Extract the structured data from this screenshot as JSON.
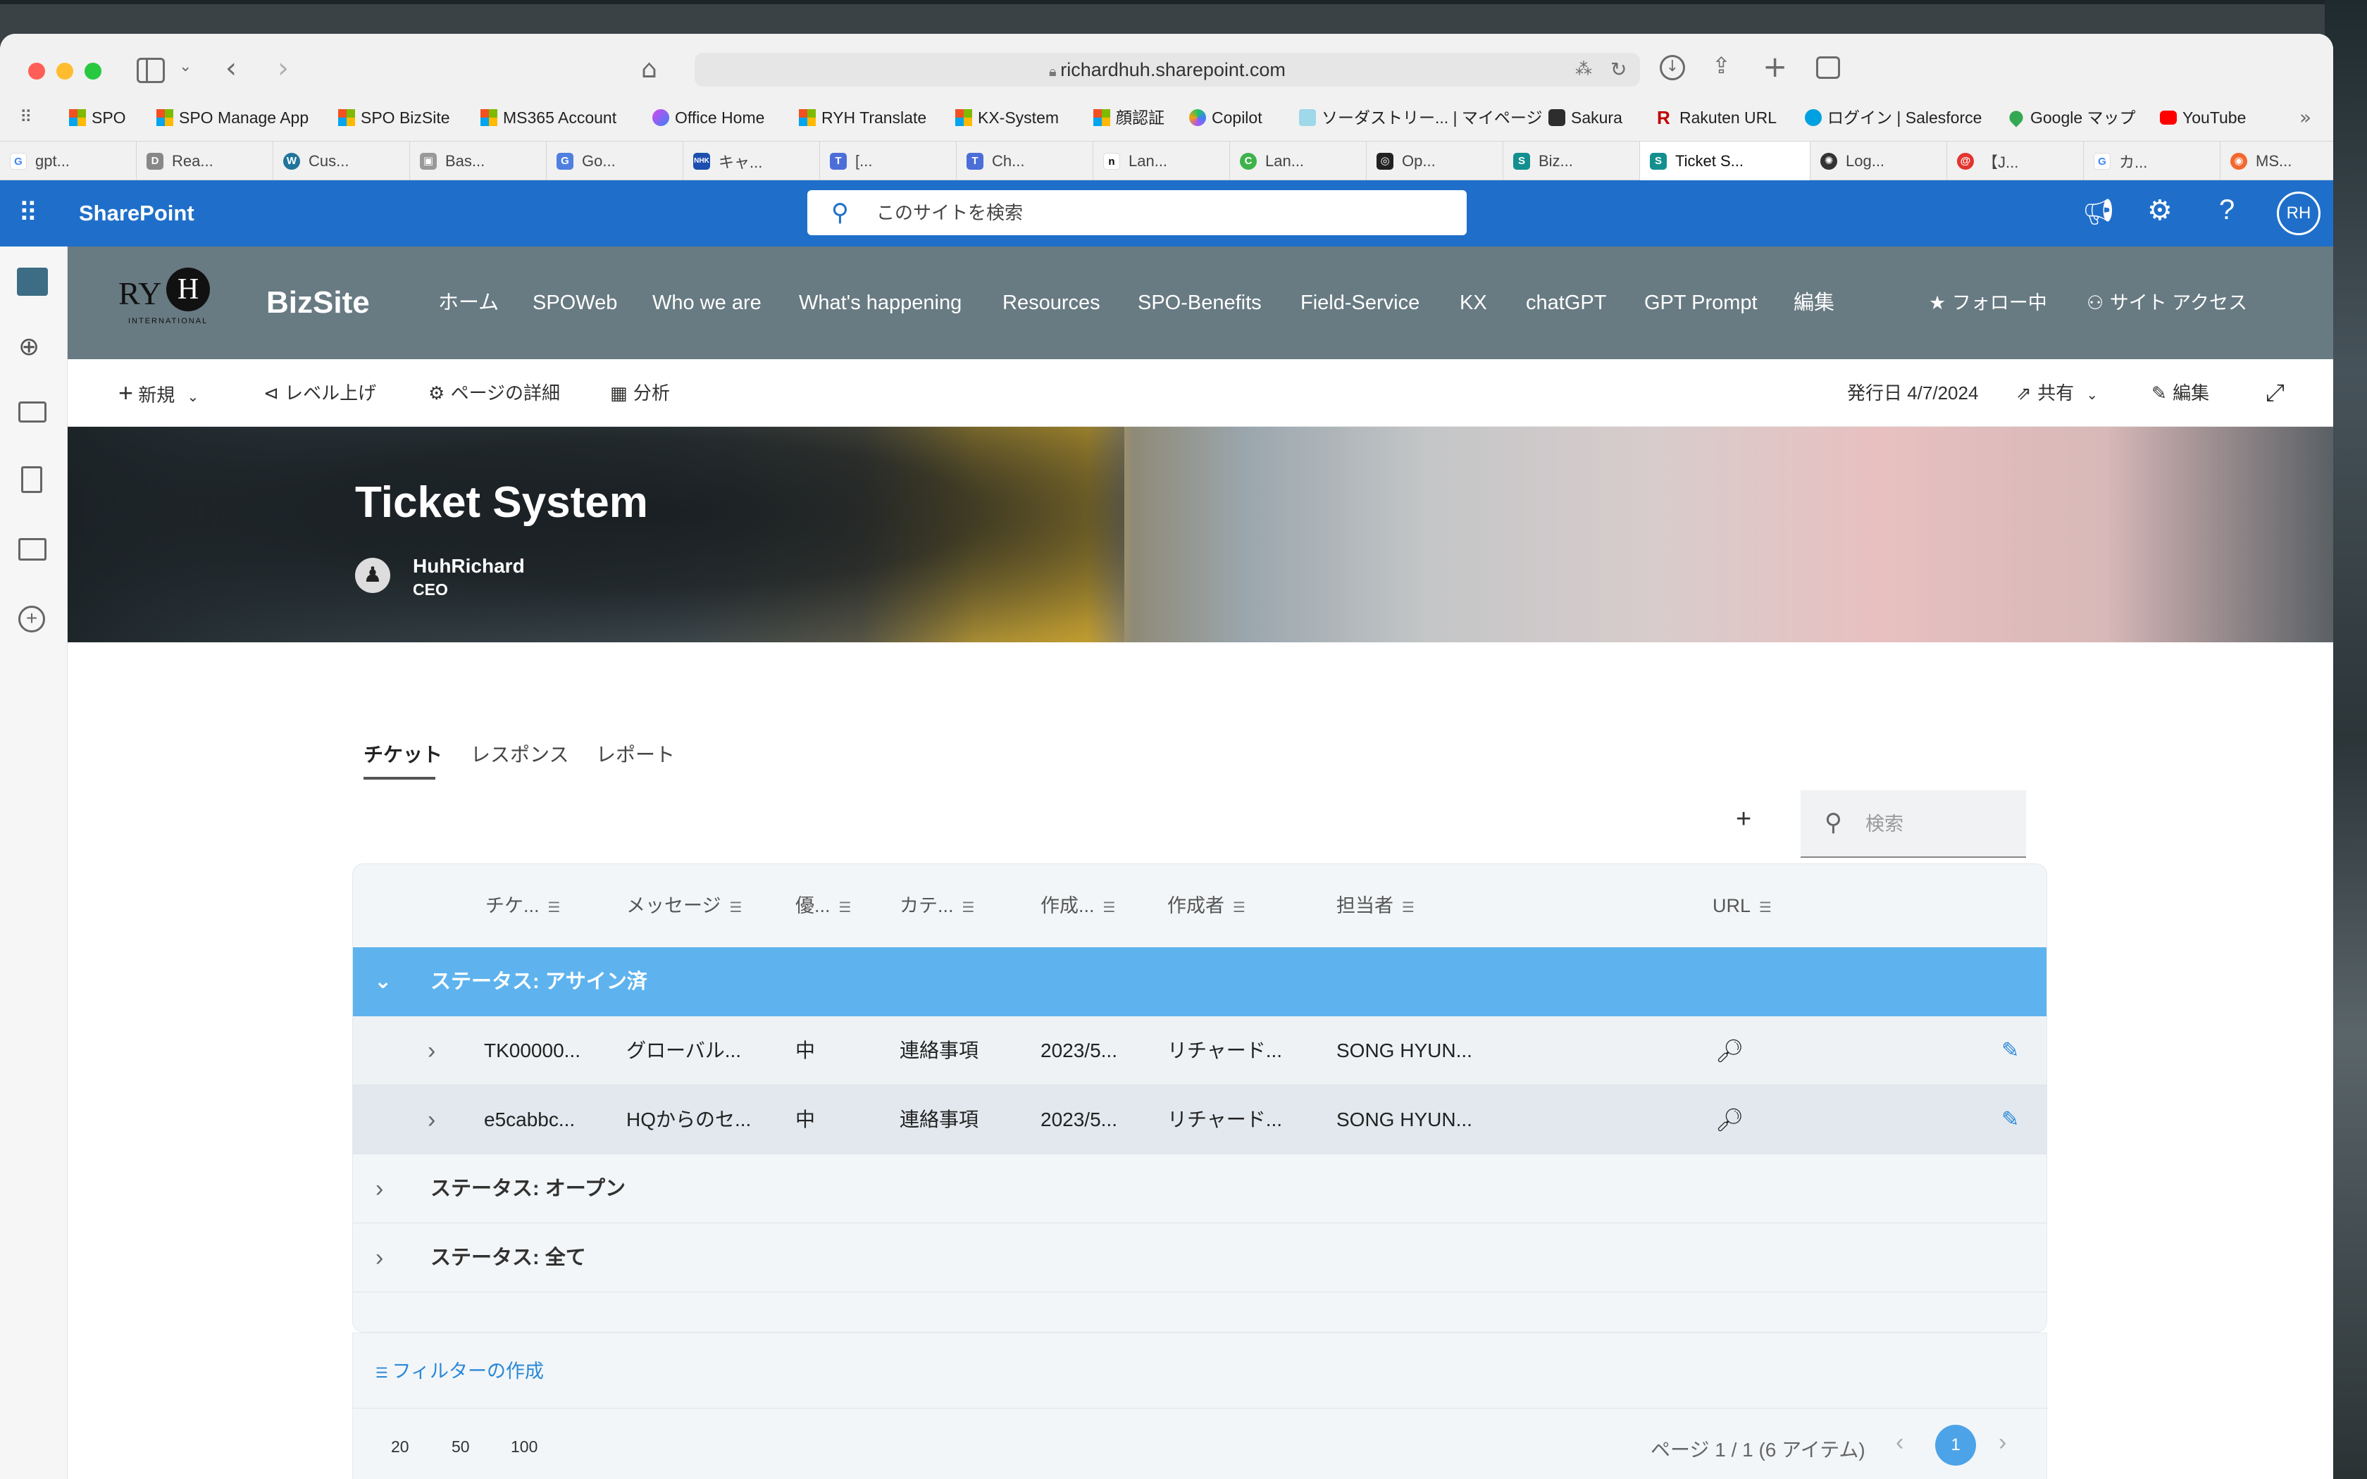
{
  "browser": {
    "url": "richardhuh.sharepoint.com"
  },
  "bookmarks": [
    "SPO",
    "SPO Manage App",
    "SPO BizSite",
    "MS365 Account",
    "Office Home",
    "RYH Translate",
    "KX-System",
    "顔認証",
    "Copilot",
    "ソーダストリー... | マイページ",
    "Sakura",
    "Rakuten URL",
    "ログイン | Salesforce",
    "Google マップ",
    "YouTube"
  ],
  "tabs": [
    "gpt...",
    "Rea...",
    "Cus...",
    "Bas...",
    "Go...",
    "キャ...",
    "[...",
    "Ch...",
    "Lan...",
    "Lan...",
    "Op...",
    "Biz...",
    "Ticket S...",
    "Log...",
    "【J...",
    "カ...",
    "MS..."
  ],
  "suite": {
    "app": "SharePoint",
    "search_placeholder": "このサイトを検索",
    "avatar": "RH"
  },
  "site": {
    "logo_text": "RY",
    "logo_sub": "INTERNATIONAL",
    "name": "BizSite",
    "nav": [
      "ホーム",
      "SPOWeb",
      "Who we are",
      "What's happening",
      "Resources",
      "SPO-Benefits",
      "Field-Service",
      "KX",
      "chatGPT",
      "GPT Prompt",
      "編集"
    ],
    "follow": "フォロー中",
    "access": "サイト アクセス"
  },
  "command": {
    "new": "新規",
    "promote": "レベル上げ",
    "details": "ページの詳細",
    "analytics": "分析",
    "published": "発行日 4/7/2024",
    "share": "共有",
    "edit": "編集"
  },
  "hero": {
    "title": "Ticket System",
    "author": "HuhRichard",
    "role": "CEO"
  },
  "pivot": [
    "チケット",
    "レスポンス",
    "レポート"
  ],
  "list": {
    "add": "+",
    "search_placeholder": "検索",
    "columns": [
      "チケ...",
      "メッセージ",
      "優...",
      "カテ...",
      "作成...",
      "作成者",
      "担当者",
      "URL"
    ],
    "groups": [
      "ステータス: アサイン済",
      "ステータス: オープン",
      "ステータス: 全て"
    ],
    "rows": [
      [
        "TK00000...",
        "グローバル...",
        "中",
        "連絡事項",
        "2023/5...",
        "リチャード...",
        "SONG HYUN..."
      ],
      [
        "e5cabbc...",
        "HQからのセ...",
        "中",
        "連絡事項",
        "2023/5...",
        "リチャード...",
        "SONG HYUN..."
      ]
    ],
    "filter": "フィルターの作成",
    "page_sizes": [
      "20",
      "50",
      "100"
    ],
    "page_info": "ページ 1 / 1 (6 アイテム)",
    "current_page": "1"
  },
  "colors": {
    "suite": "#1f6fca",
    "site_header": "#687a82",
    "group_active": "#5eb3ee",
    "accent": "#2b88d8"
  }
}
